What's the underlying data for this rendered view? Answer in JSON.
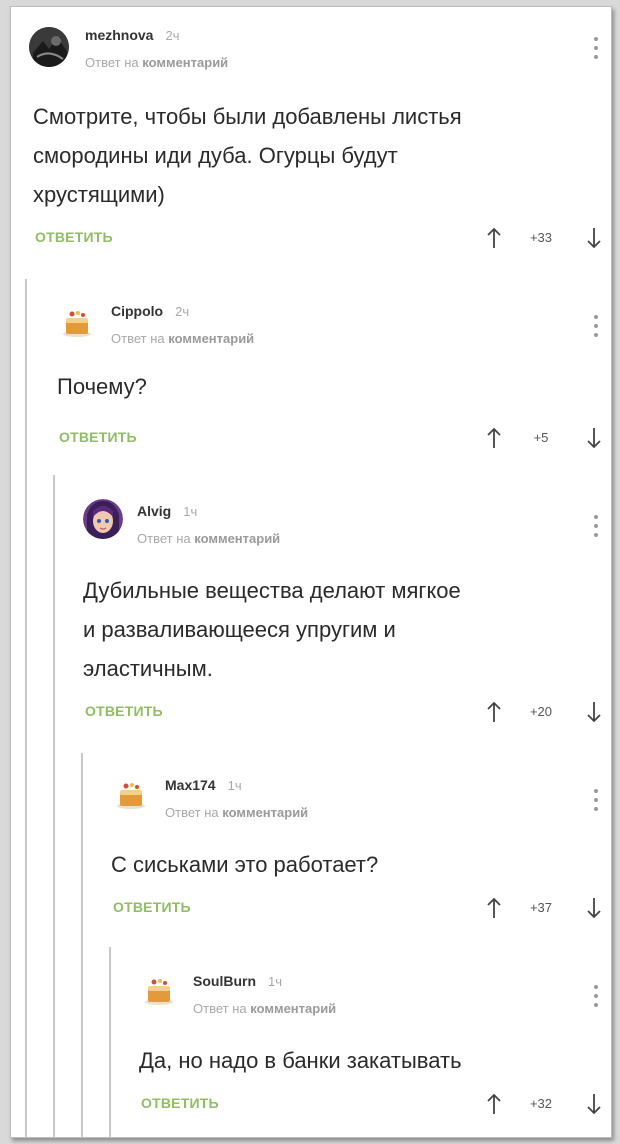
{
  "reply_to_prefix": "Ответ на",
  "reply_to_target": "комментарий",
  "reply_label": "ОТВЕТИТЬ",
  "accent_color": "#8fbd63",
  "comments": [
    {
      "author": "mezhnova",
      "time": "2ч",
      "text": "Смотрите, чтобы были добавлены листья\nсмородины иди дуба. Огурцы будут\nхрустящими)",
      "score": "+33",
      "avatar": "dark-photo-avatar"
    },
    {
      "author": "Cippolo",
      "time": "2ч",
      "text": "Почему?",
      "score": "+5",
      "avatar": "default-cake-avatar"
    },
    {
      "author": "Alvig",
      "time": "1ч",
      "text": "Дубильные вещества делают мягкое\nи разваливающееся упругим и\nэластичным.",
      "score": "+20",
      "avatar": "anime-girl-avatar"
    },
    {
      "author": "Max174",
      "time": "1ч",
      "text": "С сиськами это работает?",
      "score": "+37",
      "avatar": "default-cake-avatar"
    },
    {
      "author": "SoulBurn",
      "time": "1ч",
      "text": "Да, но надо в банки закатывать",
      "score": "+32",
      "avatar": "default-cake-avatar"
    }
  ]
}
